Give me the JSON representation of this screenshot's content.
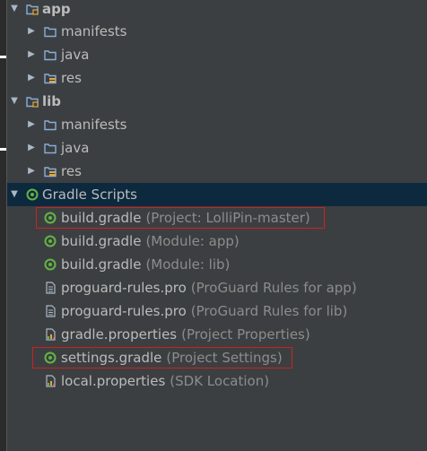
{
  "tree": {
    "app": {
      "label": "app",
      "children": [
        {
          "label": "manifests"
        },
        {
          "label": "java"
        },
        {
          "label": "res"
        }
      ]
    },
    "lib": {
      "label": "lib",
      "children": [
        {
          "label": "manifests"
        },
        {
          "label": "java"
        },
        {
          "label": "res"
        }
      ]
    },
    "gradle_scripts": {
      "label": "Gradle Scripts",
      "items": [
        {
          "name": "build.gradle",
          "hint": "(Project: LolliPin-master)"
        },
        {
          "name": "build.gradle",
          "hint": "(Module: app)"
        },
        {
          "name": "build.gradle",
          "hint": "(Module: lib)"
        },
        {
          "name": "proguard-rules.pro",
          "hint": "(ProGuard Rules for app)"
        },
        {
          "name": "proguard-rules.pro",
          "hint": "(ProGuard Rules for lib)"
        },
        {
          "name": "gradle.properties",
          "hint": "(Project Properties)"
        },
        {
          "name": "settings.gradle",
          "hint": "(Project Settings)"
        },
        {
          "name": "local.properties",
          "hint": "(SDK Location)"
        }
      ]
    }
  },
  "colors": {
    "background": "#3c3f41",
    "selection": "#0d293e",
    "text": "#bbbbbb",
    "hint": "#8c8c8c",
    "folder": "#87aedb",
    "gradle_green": "#62b543",
    "highlight_red": "#cc2222"
  },
  "icons": {
    "module": "module-folder-icon",
    "folder": "folder-icon",
    "resource": "resource-folder-icon",
    "gradle": "gradle-icon",
    "file": "text-file-icon",
    "properties": "properties-file-icon"
  }
}
